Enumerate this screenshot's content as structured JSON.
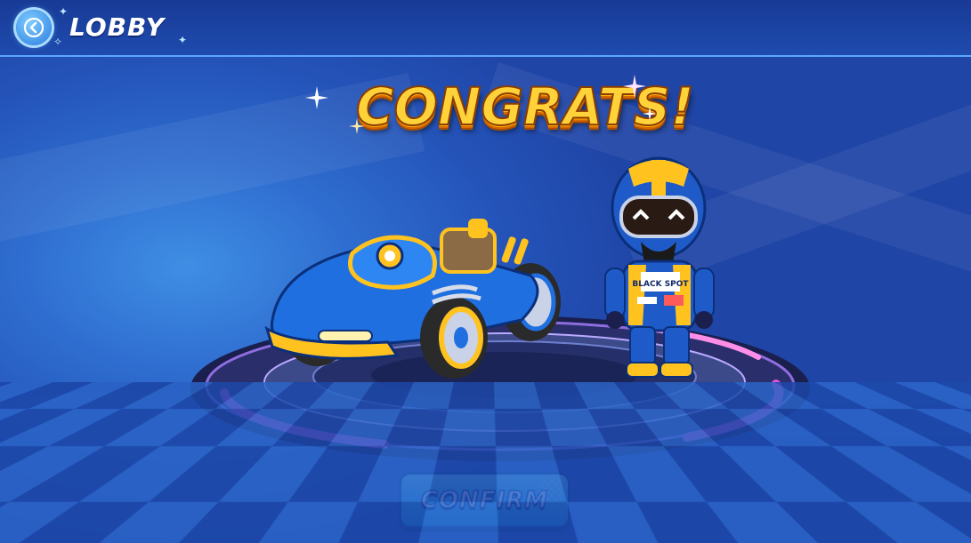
{
  "header": {
    "back_icon": "back-arrow-icon",
    "title": "LOBBY"
  },
  "reward": {
    "title": "CONGRATS!",
    "items": [
      {
        "kind": "kart",
        "icon": "kart-icon",
        "primary_color": "#1f6fe0",
        "accent_color": "#ffc21f"
      },
      {
        "kind": "racer-outfit",
        "icon": "racer-icon",
        "primary_color": "#1f5bc8",
        "accent_color": "#ffc21f",
        "suit_text": "BLACK SPOT"
      }
    ]
  },
  "confirm": {
    "label": "CONFIRM"
  },
  "colors": {
    "background": "#2453b8",
    "header": "#183a96",
    "title_gold": "#ffd23a",
    "button": "#35c2f5",
    "platform_pink": "#e04fd8"
  }
}
